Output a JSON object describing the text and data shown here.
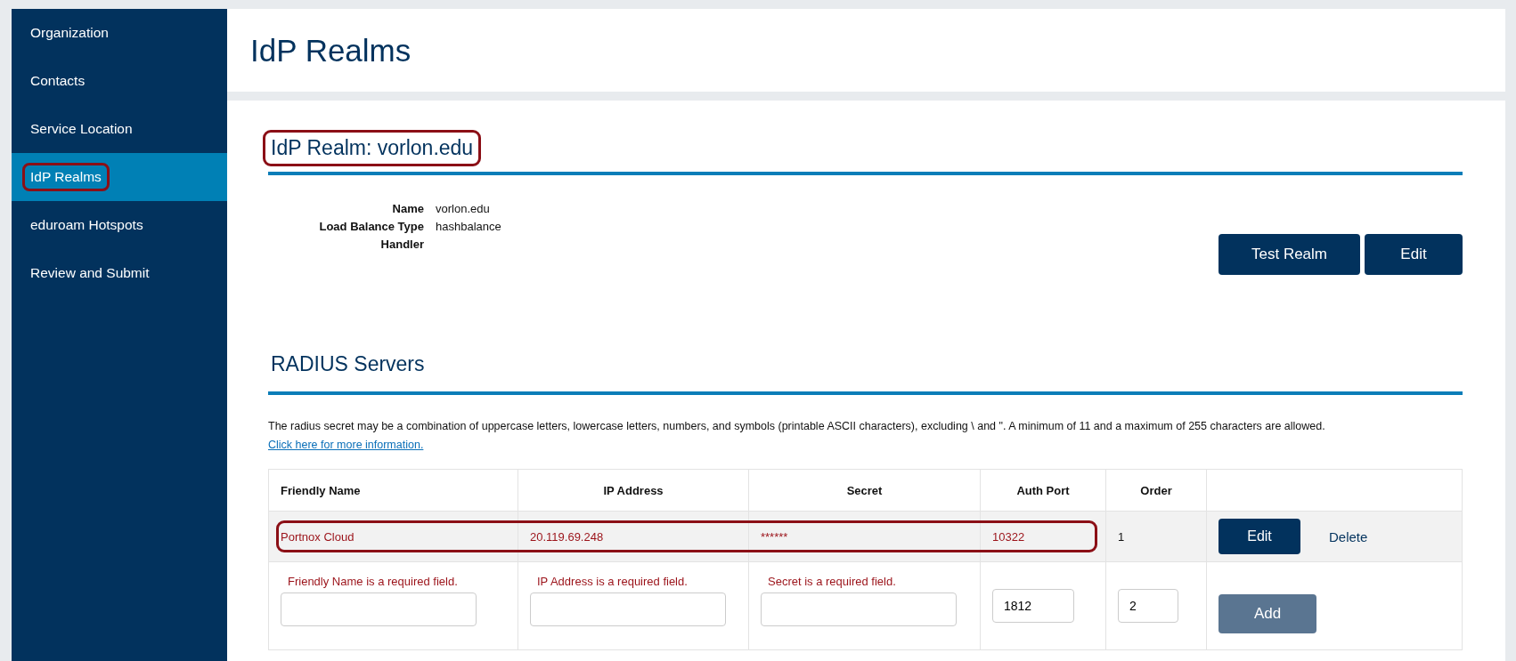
{
  "sidebar": {
    "items": [
      {
        "label": "Organization",
        "selected": false,
        "annotated": false
      },
      {
        "label": "Contacts",
        "selected": false,
        "annotated": false
      },
      {
        "label": "Service Location",
        "selected": false,
        "annotated": false
      },
      {
        "label": "IdP Realms",
        "selected": true,
        "annotated": true
      },
      {
        "label": "eduroam Hotspots",
        "selected": false,
        "annotated": false
      },
      {
        "label": "Review and Submit",
        "selected": false,
        "annotated": false
      }
    ]
  },
  "page_title": "IdP Realms",
  "realm": {
    "heading": "IdP Realm: vorlon.edu",
    "annotated": true,
    "details": [
      {
        "label": "Name",
        "value": "vorlon.edu"
      },
      {
        "label": "Load Balance Type",
        "value": "hashbalance"
      },
      {
        "label": "Handler"
      }
    ],
    "buttons": [
      "Test Realm",
      "Edit"
    ]
  },
  "radius": {
    "heading": "RADIUS Servers",
    "note": "The radius secret may be a combination of uppercase letters, lowercase letters, numbers, and symbols (printable ASCII characters), excluding \\ and \". A minimum of 11 and a maximum of 255 characters are allowed.",
    "link": "Click here for more information.",
    "table": {
      "columns": [
        "Friendly Name",
        "IP Address",
        "Secret",
        "Auth Port",
        "Order"
      ],
      "rows": [
        {
          "kind": "data",
          "annotated": true,
          "cells": [
            "Portnox Cloud",
            "20.119.69.248",
            "******",
            "10322",
            "1"
          ],
          "edit": "Edit",
          "delete": "Delete"
        },
        {
          "kind": "entry",
          "fields": [
            {
              "error": "Friendly Name is a required field."
            },
            {
              "error": "IP Address is a required field."
            },
            {
              "error": "Secret is a required field."
            },
            {
              "value": "1812"
            },
            {
              "value": "2"
            }
          ],
          "add": "Add",
          "disabled": true
        }
      ]
    }
  }
}
